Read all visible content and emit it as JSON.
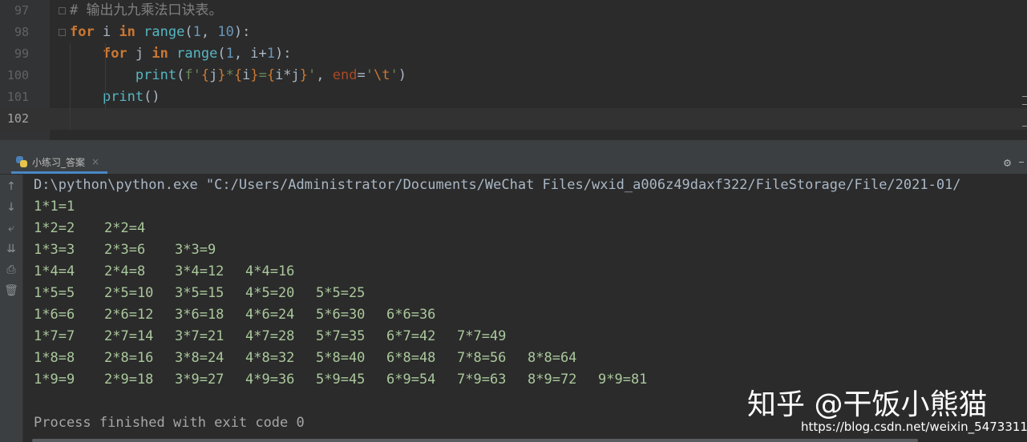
{
  "editor": {
    "line_numbers": [
      "97",
      "98",
      "99",
      "100",
      "101",
      "102"
    ],
    "lines": [
      {
        "segments": [
          {
            "t": "# 输出九九乘法口诀表。",
            "c": "cmt"
          }
        ]
      },
      {
        "segments": [
          {
            "t": "for",
            "c": "kw"
          },
          {
            "t": " i ",
            "c": ""
          },
          {
            "t": "in",
            "c": "kw"
          },
          {
            "t": " ",
            "c": ""
          },
          {
            "t": "range",
            "c": "fn"
          },
          {
            "t": "(",
            "c": ""
          },
          {
            "t": "1",
            "c": "num"
          },
          {
            "t": ", ",
            "c": ""
          },
          {
            "t": "10",
            "c": "num"
          },
          {
            "t": "):",
            "c": ""
          }
        ]
      },
      {
        "segments": [
          {
            "t": "    ",
            "c": ""
          },
          {
            "t": "for",
            "c": "kw"
          },
          {
            "t": " j ",
            "c": ""
          },
          {
            "t": "in",
            "c": "kw"
          },
          {
            "t": " ",
            "c": ""
          },
          {
            "t": "range",
            "c": "fn"
          },
          {
            "t": "(",
            "c": ""
          },
          {
            "t": "1",
            "c": "num"
          },
          {
            "t": ", i+",
            "c": ""
          },
          {
            "t": "1",
            "c": "num"
          },
          {
            "t": "):",
            "c": ""
          }
        ]
      },
      {
        "segments": [
          {
            "t": "        ",
            "c": ""
          },
          {
            "t": "print",
            "c": "fn"
          },
          {
            "t": "(",
            "c": ""
          },
          {
            "t": "f'",
            "c": "str"
          },
          {
            "t": "{",
            "c": "brace"
          },
          {
            "t": "j",
            "c": ""
          },
          {
            "t": "}",
            "c": "brace"
          },
          {
            "t": "*",
            "c": "str"
          },
          {
            "t": "{",
            "c": "brace"
          },
          {
            "t": "i",
            "c": ""
          },
          {
            "t": "}",
            "c": "brace"
          },
          {
            "t": "=",
            "c": "str"
          },
          {
            "t": "{",
            "c": "brace"
          },
          {
            "t": "i*j",
            "c": ""
          },
          {
            "t": "}",
            "c": "brace"
          },
          {
            "t": "'",
            "c": "str"
          },
          {
            "t": ", ",
            "c": ""
          },
          {
            "t": "end",
            "c": "named"
          },
          {
            "t": "=",
            "c": ""
          },
          {
            "t": "'",
            "c": "str"
          },
          {
            "t": "\\t",
            "c": "esc"
          },
          {
            "t": "'",
            "c": "str"
          },
          {
            "t": ")",
            "c": ""
          }
        ]
      },
      {
        "segments": [
          {
            "t": "    ",
            "c": ""
          },
          {
            "t": "print",
            "c": "fn"
          },
          {
            "t": "()",
            "c": ""
          }
        ]
      },
      {
        "segments": []
      }
    ]
  },
  "run_panel": {
    "tab_label": "小练习_答案",
    "tab_close": "×",
    "settings_icon": "gear-icon",
    "toolbar_icons": [
      "arrow-up-icon",
      "arrow-down-icon",
      "soft-wrap-icon",
      "scroll-to-end-icon",
      "print-icon",
      "trash-icon"
    ]
  },
  "console": {
    "command": "D:\\python\\python.exe \"C:/Users/Administrator/Documents/WeChat Files/wxid_a006z49daxf322/FileStorage/File/2021-01/",
    "rows": [
      [
        "1*1=1"
      ],
      [
        "1*2=2",
        "2*2=4"
      ],
      [
        "1*3=3",
        "2*3=6",
        "3*3=9"
      ],
      [
        "1*4=4",
        "2*4=8",
        "3*4=12",
        "4*4=16"
      ],
      [
        "1*5=5",
        "2*5=10",
        "3*5=15",
        "4*5=20",
        "5*5=25"
      ],
      [
        "1*6=6",
        "2*6=12",
        "3*6=18",
        "4*6=24",
        "5*6=30",
        "6*6=36"
      ],
      [
        "1*7=7",
        "2*7=14",
        "3*7=21",
        "4*7=28",
        "5*7=35",
        "6*7=42",
        "7*7=49"
      ],
      [
        "1*8=8",
        "2*8=16",
        "3*8=24",
        "4*8=32",
        "5*8=40",
        "6*8=48",
        "7*8=56",
        "8*8=64"
      ],
      [
        "1*9=9",
        "2*9=18",
        "3*9=27",
        "4*9=36",
        "5*9=45",
        "6*9=54",
        "7*9=63",
        "8*9=72",
        "9*9=81"
      ]
    ],
    "exit_message": "Process finished with exit code 0"
  },
  "watermark": {
    "main": "知乎 @干饭小熊猫",
    "url": "https://blog.csdn.net/weixin_54733110"
  }
}
